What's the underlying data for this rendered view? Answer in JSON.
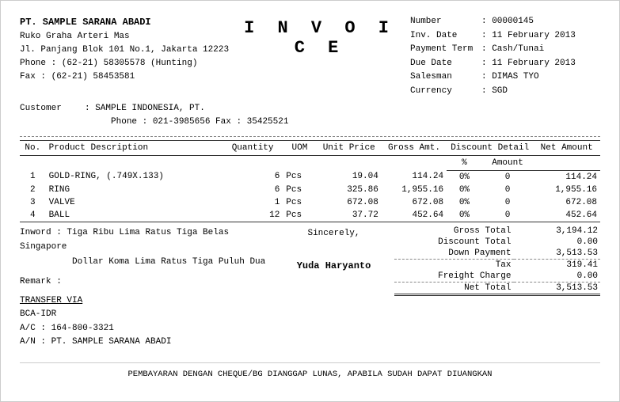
{
  "company": {
    "name": "PT. SAMPLE SARANA ABADI",
    "address1": "Ruko Graha Arteri Mas",
    "address2": "Jl. Panjang Blok 101 No.1, Jakarta 12223",
    "phone": "Phone  :  (62-21) 58305578 (Hunting)",
    "fax": "Fax       :  (62-21) 58453581"
  },
  "invoice_title": "I N V O I C E",
  "meta": {
    "number_label": "Number",
    "number_value": ": 00000145",
    "inv_date_label": "Inv. Date",
    "inv_date_value": ": 11 February 2013",
    "payment_term_label": "Payment Term",
    "payment_term_value": ": Cash/Tunai",
    "due_date_label": "Due Date",
    "due_date_value": ": 11 February 2013",
    "salesman_label": "Salesman",
    "salesman_value": ": DIMAS TYO",
    "currency_label": "Currency",
    "currency_value": ": SGD"
  },
  "customer": {
    "label": "Customer",
    "name": ": SAMPLE  INDONESIA, PT.",
    "contact": "Phone : 021-3985656   Fax : 35425521"
  },
  "table": {
    "headers": {
      "no": "No.",
      "desc": "Product Description",
      "qty": "Quantity",
      "uom": "UOM",
      "unit_price": "Unit Price",
      "gross_amt": "Gross Amt.",
      "discount_detail": "Discount Detail",
      "disc_pct": "%",
      "disc_amt": "Amount",
      "net_amount": "Net Amount"
    },
    "rows": [
      {
        "no": "1",
        "desc": "GOLD-RING, (.749X.133)",
        "qty": "6",
        "uom": "Pcs",
        "unit_price": "19.04",
        "gross_amt": "114.24",
        "disc_pct": "0%",
        "disc_amt": "0",
        "net_amount": "114.24"
      },
      {
        "no": "2",
        "desc": "RING",
        "qty": "6",
        "uom": "Pcs",
        "unit_price": "325.86",
        "gross_amt": "1,955.16",
        "disc_pct": "0%",
        "disc_amt": "0",
        "net_amount": "1,955.16"
      },
      {
        "no": "3",
        "desc": "VALVE",
        "qty": "1",
        "uom": "Pcs",
        "unit_price": "672.08",
        "gross_amt": "672.08",
        "disc_pct": "0%",
        "disc_amt": "0",
        "net_amount": "672.08"
      },
      {
        "no": "4",
        "desc": "BALL",
        "qty": "12",
        "uom": "Pcs",
        "unit_price": "37.72",
        "gross_amt": "452.64",
        "disc_pct": "0%",
        "disc_amt": "0",
        "net_amount": "452.64"
      }
    ]
  },
  "inword": {
    "label": "Inword :",
    "text": "Tiga Ribu Lima Ratus Tiga Belas Singapore",
    "text2": "Dollar Koma Lima Ratus Tiga Puluh Dua"
  },
  "remark": {
    "label": "Remark :"
  },
  "sincerely": "Sincerely,",
  "totals": {
    "gross_total_label": "Gross Total",
    "gross_total_value": "3,194.12",
    "discount_total_label": "Discount Total",
    "discount_total_value": "0.00",
    "down_payment_label": "Down Payment",
    "down_payment_value": "3,513.53",
    "tax_label": "Tax",
    "tax_value": "319.41",
    "freight_label": "Freight Charge",
    "freight_value": "0.00",
    "net_total_label": "Net Total",
    "net_total_value": "3,513.53"
  },
  "transfer": {
    "via_label": "TRANSFER VIA",
    "bank": "BCA-IDR",
    "ac": "A/C : 164-800-3321",
    "an": "A/N : PT. SAMPLE SARANA ABADI"
  },
  "signatory": "Yuda  Haryanto",
  "footer_note": "PEMBAYARAN DENGAN CHEQUE/BG DIANGGAP LUNAS, APABILA SUDAH DAPAT DIUANGKAN"
}
